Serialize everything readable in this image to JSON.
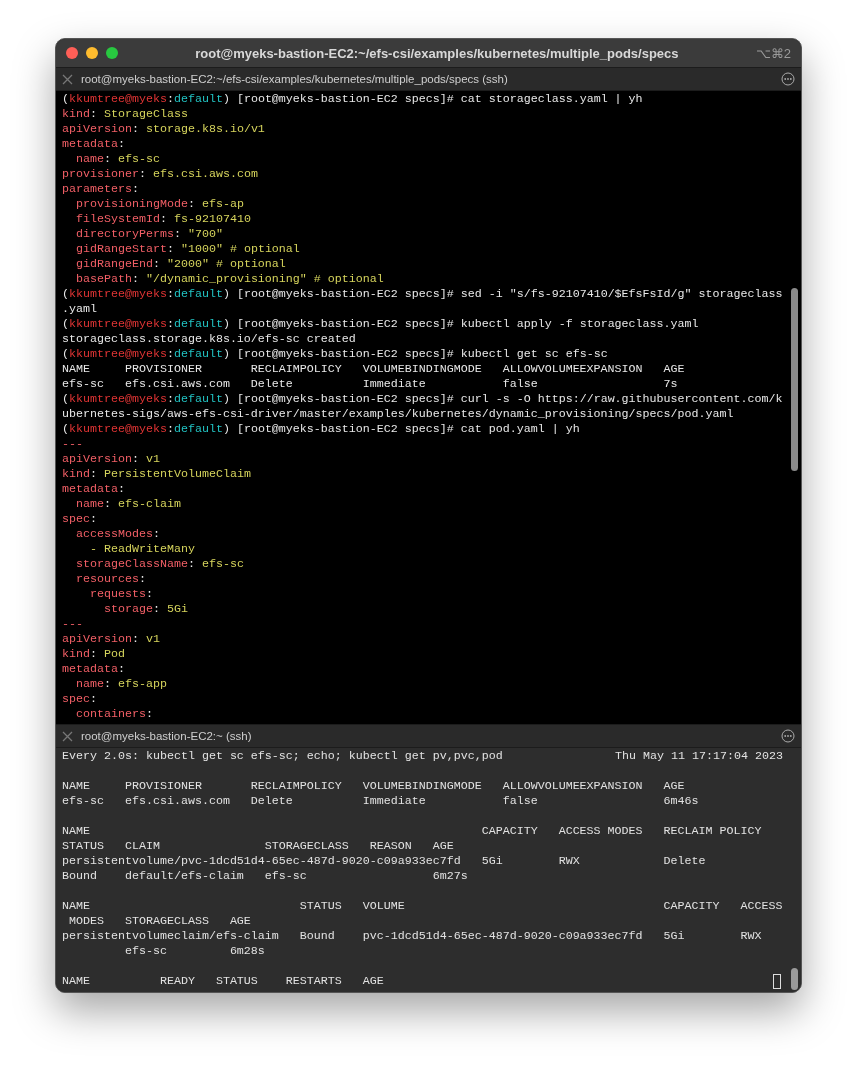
{
  "window": {
    "title": "root@myeks-bastion-EC2:~/efs-csi/examples/kubernetes/multiple_pods/specs",
    "shortcut": "⌥⌘2"
  },
  "panes": [
    {
      "tab_title": "root@myeks-bastion-EC2:~/efs-csi/examples/kubernetes/multiple_pods/specs (ssh)",
      "lines": [
        [
          {
            "kind": "text",
            "text": "("
          },
          {
            "kind": "user",
            "text": "kkumtree@myeks"
          },
          {
            "kind": "text",
            "text": ":"
          },
          {
            "kind": "ns",
            "text": "default"
          },
          {
            "kind": "text",
            "text": ") [root@myeks-bastion-EC2 specs]# cat storageclass.yaml | yh"
          }
        ],
        [
          {
            "kind": "key",
            "text": "kind"
          },
          {
            "kind": "text",
            "text": ": "
          },
          {
            "kind": "value",
            "text": "StorageClass"
          }
        ],
        [
          {
            "kind": "key",
            "text": "apiVersion"
          },
          {
            "kind": "text",
            "text": ": "
          },
          {
            "kind": "value",
            "text": "storage.k8s.io/v1"
          }
        ],
        [
          {
            "kind": "key",
            "text": "metadata"
          },
          {
            "kind": "text",
            "text": ":"
          }
        ],
        [
          {
            "kind": "key",
            "text": "  name"
          },
          {
            "kind": "text",
            "text": ": "
          },
          {
            "kind": "value",
            "text": "efs-sc"
          }
        ],
        [
          {
            "kind": "key",
            "text": "provisioner"
          },
          {
            "kind": "text",
            "text": ": "
          },
          {
            "kind": "value",
            "text": "efs.csi.aws.com"
          }
        ],
        [
          {
            "kind": "key",
            "text": "parameters"
          },
          {
            "kind": "text",
            "text": ":"
          }
        ],
        [
          {
            "kind": "key",
            "text": "  provisioningMode"
          },
          {
            "kind": "text",
            "text": ": "
          },
          {
            "kind": "value",
            "text": "efs-ap"
          }
        ],
        [
          {
            "kind": "key",
            "text": "  fileSystemId"
          },
          {
            "kind": "text",
            "text": ": "
          },
          {
            "kind": "value",
            "text": "fs-92107410"
          }
        ],
        [
          {
            "kind": "key",
            "text": "  directoryPerms"
          },
          {
            "kind": "text",
            "text": ": "
          },
          {
            "kind": "value",
            "text": "\"700\""
          }
        ],
        [
          {
            "kind": "key",
            "text": "  gidRangeStart"
          },
          {
            "kind": "text",
            "text": ": "
          },
          {
            "kind": "value",
            "text": "\"1000\" # optional"
          }
        ],
        [
          {
            "kind": "key",
            "text": "  gidRangeEnd"
          },
          {
            "kind": "text",
            "text": ": "
          },
          {
            "kind": "value",
            "text": "\"2000\" # optional"
          }
        ],
        [
          {
            "kind": "key",
            "text": "  basePath"
          },
          {
            "kind": "text",
            "text": ": "
          },
          {
            "kind": "value",
            "text": "\"/dynamic_provisioning\" # optional"
          }
        ],
        [
          {
            "kind": "text",
            "text": "("
          },
          {
            "kind": "user",
            "text": "kkumtree@myeks"
          },
          {
            "kind": "text",
            "text": ":"
          },
          {
            "kind": "ns",
            "text": "default"
          },
          {
            "kind": "text",
            "text": ") [root@myeks-bastion-EC2 specs]# sed -i \"s/fs-92107410/$EfsFsId/g\" storageclass"
          }
        ],
        [
          {
            "kind": "text",
            "text": ".yaml"
          }
        ],
        [
          {
            "kind": "text",
            "text": "("
          },
          {
            "kind": "user",
            "text": "kkumtree@myeks"
          },
          {
            "kind": "text",
            "text": ":"
          },
          {
            "kind": "ns",
            "text": "default"
          },
          {
            "kind": "text",
            "text": ") [root@myeks-bastion-EC2 specs]# kubectl apply -f storageclass.yaml"
          }
        ],
        [
          {
            "kind": "text",
            "text": "storageclass.storage.k8s.io/efs-sc created"
          }
        ],
        [
          {
            "kind": "text",
            "text": "("
          },
          {
            "kind": "user",
            "text": "kkumtree@myeks"
          },
          {
            "kind": "text",
            "text": ":"
          },
          {
            "kind": "ns",
            "text": "default"
          },
          {
            "kind": "text",
            "text": ") [root@myeks-bastion-EC2 specs]# kubectl get sc efs-sc"
          }
        ],
        [
          {
            "kind": "text",
            "text": "NAME     PROVISIONER       RECLAIMPOLICY   VOLUMEBINDINGMODE   ALLOWVOLUMEEXPANSION   AGE"
          }
        ],
        [
          {
            "kind": "text",
            "text": "efs-sc   efs.csi.aws.com   Delete          Immediate           false                  7s"
          }
        ],
        [
          {
            "kind": "text",
            "text": "("
          },
          {
            "kind": "user",
            "text": "kkumtree@myeks"
          },
          {
            "kind": "text",
            "text": ":"
          },
          {
            "kind": "ns",
            "text": "default"
          },
          {
            "kind": "text",
            "text": ") [root@myeks-bastion-EC2 specs]# curl -s -O https://raw.githubusercontent.com/k"
          }
        ],
        [
          {
            "kind": "text",
            "text": "ubernetes-sigs/aws-efs-csi-driver/master/examples/kubernetes/dynamic_provisioning/specs/pod.yaml"
          }
        ],
        [
          {
            "kind": "text",
            "text": "("
          },
          {
            "kind": "user",
            "text": "kkumtree@myeks"
          },
          {
            "kind": "text",
            "text": ":"
          },
          {
            "kind": "ns",
            "text": "default"
          },
          {
            "kind": "text",
            "text": ") [root@myeks-bastion-EC2 specs]# cat pod.yaml | yh"
          }
        ],
        [
          {
            "kind": "key",
            "text": "---"
          }
        ],
        [
          {
            "kind": "key",
            "text": "apiVersion"
          },
          {
            "kind": "text",
            "text": ": "
          },
          {
            "kind": "value",
            "text": "v1"
          }
        ],
        [
          {
            "kind": "key",
            "text": "kind"
          },
          {
            "kind": "text",
            "text": ": "
          },
          {
            "kind": "value",
            "text": "PersistentVolumeClaim"
          }
        ],
        [
          {
            "kind": "key",
            "text": "metadata"
          },
          {
            "kind": "text",
            "text": ":"
          }
        ],
        [
          {
            "kind": "key",
            "text": "  name"
          },
          {
            "kind": "text",
            "text": ": "
          },
          {
            "kind": "value",
            "text": "efs-claim"
          }
        ],
        [
          {
            "kind": "key",
            "text": "spec"
          },
          {
            "kind": "text",
            "text": ":"
          }
        ],
        [
          {
            "kind": "key",
            "text": "  accessModes"
          },
          {
            "kind": "text",
            "text": ":"
          }
        ],
        [
          {
            "kind": "value",
            "text": "    - ReadWriteMany"
          }
        ],
        [
          {
            "kind": "key",
            "text": "  storageClassName"
          },
          {
            "kind": "text",
            "text": ": "
          },
          {
            "kind": "value",
            "text": "efs-sc"
          }
        ],
        [
          {
            "kind": "key",
            "text": "  resources"
          },
          {
            "kind": "text",
            "text": ":"
          }
        ],
        [
          {
            "kind": "key",
            "text": "    requests"
          },
          {
            "kind": "text",
            "text": ":"
          }
        ],
        [
          {
            "kind": "key",
            "text": "      storage"
          },
          {
            "kind": "text",
            "text": ": "
          },
          {
            "kind": "value",
            "text": "5Gi"
          }
        ],
        [
          {
            "kind": "key",
            "text": "---"
          }
        ],
        [
          {
            "kind": "key",
            "text": "apiVersion"
          },
          {
            "kind": "text",
            "text": ": "
          },
          {
            "kind": "value",
            "text": "v1"
          }
        ],
        [
          {
            "kind": "key",
            "text": "kind"
          },
          {
            "kind": "text",
            "text": ": "
          },
          {
            "kind": "value",
            "text": "Pod"
          }
        ],
        [
          {
            "kind": "key",
            "text": "metadata"
          },
          {
            "kind": "text",
            "text": ":"
          }
        ],
        [
          {
            "kind": "key",
            "text": "  name"
          },
          {
            "kind": "text",
            "text": ": "
          },
          {
            "kind": "value",
            "text": "efs-app"
          }
        ],
        [
          {
            "kind": "key",
            "text": "spec"
          },
          {
            "kind": "text",
            "text": ":"
          }
        ],
        [
          {
            "kind": "key",
            "text": "  containers"
          },
          {
            "kind": "text",
            "text": ":"
          }
        ]
      ]
    },
    {
      "tab_title": "root@myeks-bastion-EC2:~ (ssh)",
      "watch_header": {
        "command": "Every 2.0s: kubectl get sc efs-sc; echo; kubectl get pv,pvc,pod",
        "time": "Thu May 11 17:17:04 2023"
      },
      "blocks": [
        [
          "NAME     PROVISIONER       RECLAIMPOLICY   VOLUMEBINDINGMODE   ALLOWVOLUMEEXPANSION   AGE",
          "efs-sc   efs.csi.aws.com   Delete          Immediate           false                  6m46s"
        ],
        [
          "NAME                                                        CAPACITY   ACCESS MODES   RECLAIM POLICY",
          "STATUS   CLAIM               STORAGECLASS   REASON   AGE",
          "persistentvolume/pvc-1dcd51d4-65ec-487d-9020-c09a933ec7fd   5Gi        RWX            Delete",
          "Bound    default/efs-claim   efs-sc                  6m27s"
        ],
        [
          "NAME                              STATUS   VOLUME                                     CAPACITY   ACCESS",
          " MODES   STORAGECLASS   AGE",
          "persistentvolumeclaim/efs-claim   Bound    pvc-1dcd51d4-65ec-487d-9020-c09a933ec7fd   5Gi        RWX",
          "         efs-sc         6m28s"
        ],
        [
          "NAME          READY   STATUS    RESTARTS   AGE"
        ]
      ]
    }
  ]
}
